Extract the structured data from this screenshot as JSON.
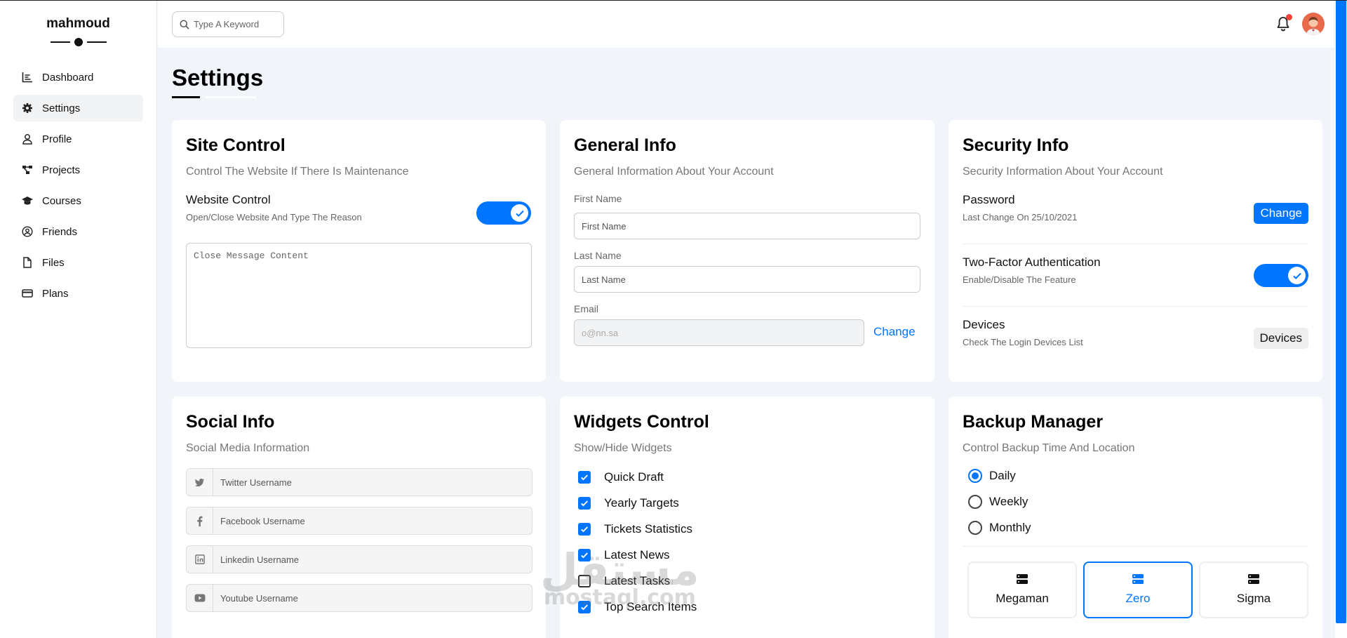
{
  "brand": {
    "name": "mahmoud"
  },
  "nav": {
    "items": [
      {
        "label": "Dashboard",
        "icon": "chart-line-icon"
      },
      {
        "label": "Settings",
        "icon": "gear-icon"
      },
      {
        "label": "Profile",
        "icon": "user-icon"
      },
      {
        "label": "Projects",
        "icon": "diagram-project-icon"
      },
      {
        "label": "Courses",
        "icon": "graduation-cap-icon"
      },
      {
        "label": "Friends",
        "icon": "user-circle-icon"
      },
      {
        "label": "Files",
        "icon": "file-icon"
      },
      {
        "label": "Plans",
        "icon": "credit-card-icon"
      }
    ],
    "active": "Settings"
  },
  "header": {
    "search_placeholder": "Type A Keyword",
    "notification_icon": "bell-icon",
    "has_notification": true
  },
  "page": {
    "title": "Settings"
  },
  "site_control": {
    "title": "Site Control",
    "subtitle": "Control The Website If There Is Maintenance",
    "row_title": "Website Control",
    "row_sub": "Open/Close Website And Type The Reason",
    "toggle_on": true,
    "message_placeholder": "Close Message Content"
  },
  "general_info": {
    "title": "General Info",
    "subtitle": "General Information About Your Account",
    "first_name_label": "First Name",
    "first_name_placeholder": "First Name",
    "last_name_label": "Last Name",
    "last_name_placeholder": "Last Name",
    "email_label": "Email",
    "email_placeholder": "o@nn.sa",
    "change_label": "Change"
  },
  "security_info": {
    "title": "Security Info",
    "subtitle": "Security Information About Your Account",
    "password_title": "Password",
    "password_sub": "Last Change On 25/10/2021",
    "password_button": "Change",
    "twofa_title": "Two-Factor Authentication",
    "twofa_sub": "Enable/Disable The Feature",
    "twofa_on": true,
    "devices_title": "Devices",
    "devices_sub": "Check The Login Devices List",
    "devices_button": "Devices"
  },
  "social_info": {
    "title": "Social Info",
    "subtitle": "Social Media Information",
    "fields": [
      {
        "placeholder": "Twitter Username",
        "icon": "twitter-icon"
      },
      {
        "placeholder": "Facebook Username",
        "icon": "facebook-icon"
      },
      {
        "placeholder": "Linkedin Username",
        "icon": "linkedin-icon"
      },
      {
        "placeholder": "Youtube Username",
        "icon": "youtube-icon"
      }
    ]
  },
  "widgets_control": {
    "title": "Widgets Control",
    "subtitle": "Show/Hide Widgets",
    "items": [
      {
        "label": "Quick Draft",
        "checked": true
      },
      {
        "label": "Yearly Targets",
        "checked": true
      },
      {
        "label": "Tickets Statistics",
        "checked": true
      },
      {
        "label": "Latest News",
        "checked": true
      },
      {
        "label": "Latest Tasks",
        "checked": false
      },
      {
        "label": "Top Search Items",
        "checked": true
      }
    ]
  },
  "backup_manager": {
    "title": "Backup Manager",
    "subtitle": "Control Backup Time And Location",
    "options": [
      {
        "label": "Daily",
        "selected": true
      },
      {
        "label": "Weekly",
        "selected": false
      },
      {
        "label": "Monthly",
        "selected": false
      }
    ],
    "servers": [
      {
        "label": "Megaman",
        "active": false,
        "icon": "server-icon"
      },
      {
        "label": "Zero",
        "active": true,
        "icon": "server-icon"
      },
      {
        "label": "Sigma",
        "active": false,
        "icon": "server-icon"
      }
    ]
  },
  "watermark": {
    "arabic": "مستقل",
    "latin": "mostaql.com"
  },
  "colors": {
    "accent": "#0075ff",
    "background": "#f1f5f9",
    "muted_text": "#777777"
  }
}
